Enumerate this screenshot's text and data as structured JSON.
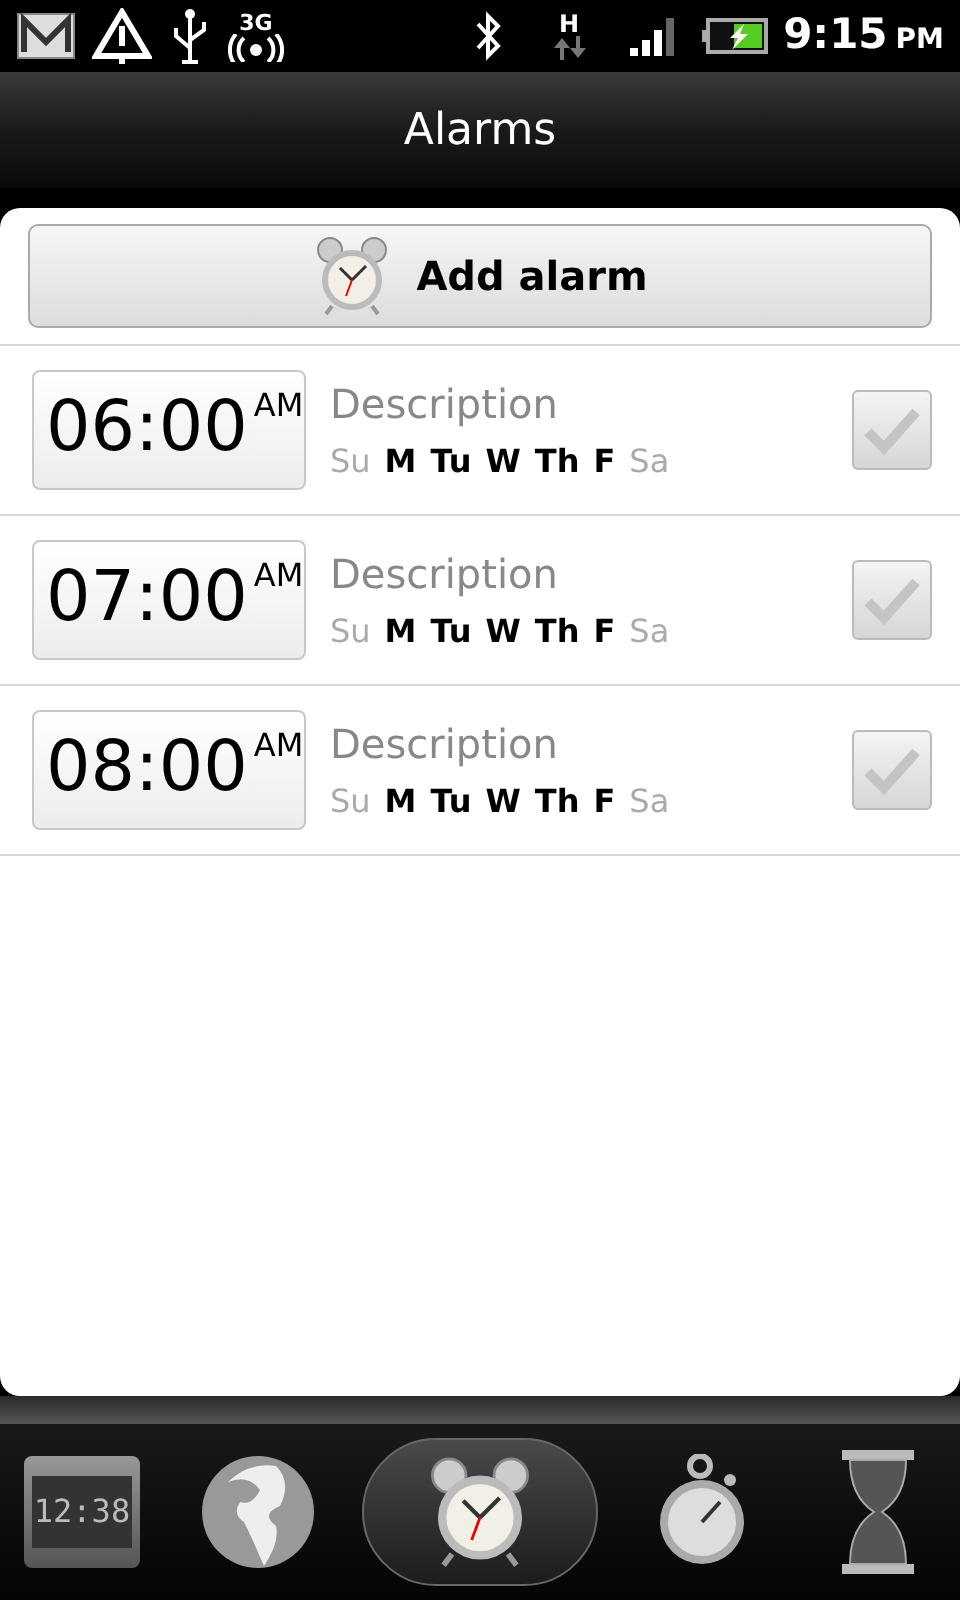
{
  "status_bar": {
    "network": "3G",
    "data": "H",
    "time": "9:15",
    "ampm": "PM"
  },
  "title": "Alarms",
  "add_button": {
    "label": "Add alarm"
  },
  "alarms": [
    {
      "time": "06:00",
      "ampm": "AM",
      "description": "Description",
      "checked": false,
      "days": [
        {
          "label": "Su",
          "on": false
        },
        {
          "label": "M",
          "on": true
        },
        {
          "label": "Tu",
          "on": true
        },
        {
          "label": "W",
          "on": true
        },
        {
          "label": "Th",
          "on": true
        },
        {
          "label": "F",
          "on": true
        },
        {
          "label": "Sa",
          "on": false
        }
      ]
    },
    {
      "time": "07:00",
      "ampm": "AM",
      "description": "Description",
      "checked": false,
      "days": [
        {
          "label": "Su",
          "on": false
        },
        {
          "label": "M",
          "on": true
        },
        {
          "label": "Tu",
          "on": true
        },
        {
          "label": "W",
          "on": true
        },
        {
          "label": "Th",
          "on": true
        },
        {
          "label": "F",
          "on": true
        },
        {
          "label": "Sa",
          "on": false
        }
      ]
    },
    {
      "time": "08:00",
      "ampm": "AM",
      "description": "Description",
      "checked": false,
      "days": [
        {
          "label": "Su",
          "on": false
        },
        {
          "label": "M",
          "on": true
        },
        {
          "label": "Tu",
          "on": true
        },
        {
          "label": "W",
          "on": true
        },
        {
          "label": "Th",
          "on": true
        },
        {
          "label": "F",
          "on": true
        },
        {
          "label": "Sa",
          "on": false
        }
      ]
    }
  ],
  "tabs": [
    {
      "kind": "desk_clock",
      "text": "12:38",
      "selected": false
    },
    {
      "kind": "world",
      "selected": false
    },
    {
      "kind": "alarm",
      "selected": true
    },
    {
      "kind": "stopwatch",
      "selected": false
    },
    {
      "kind": "timer",
      "selected": false
    }
  ]
}
